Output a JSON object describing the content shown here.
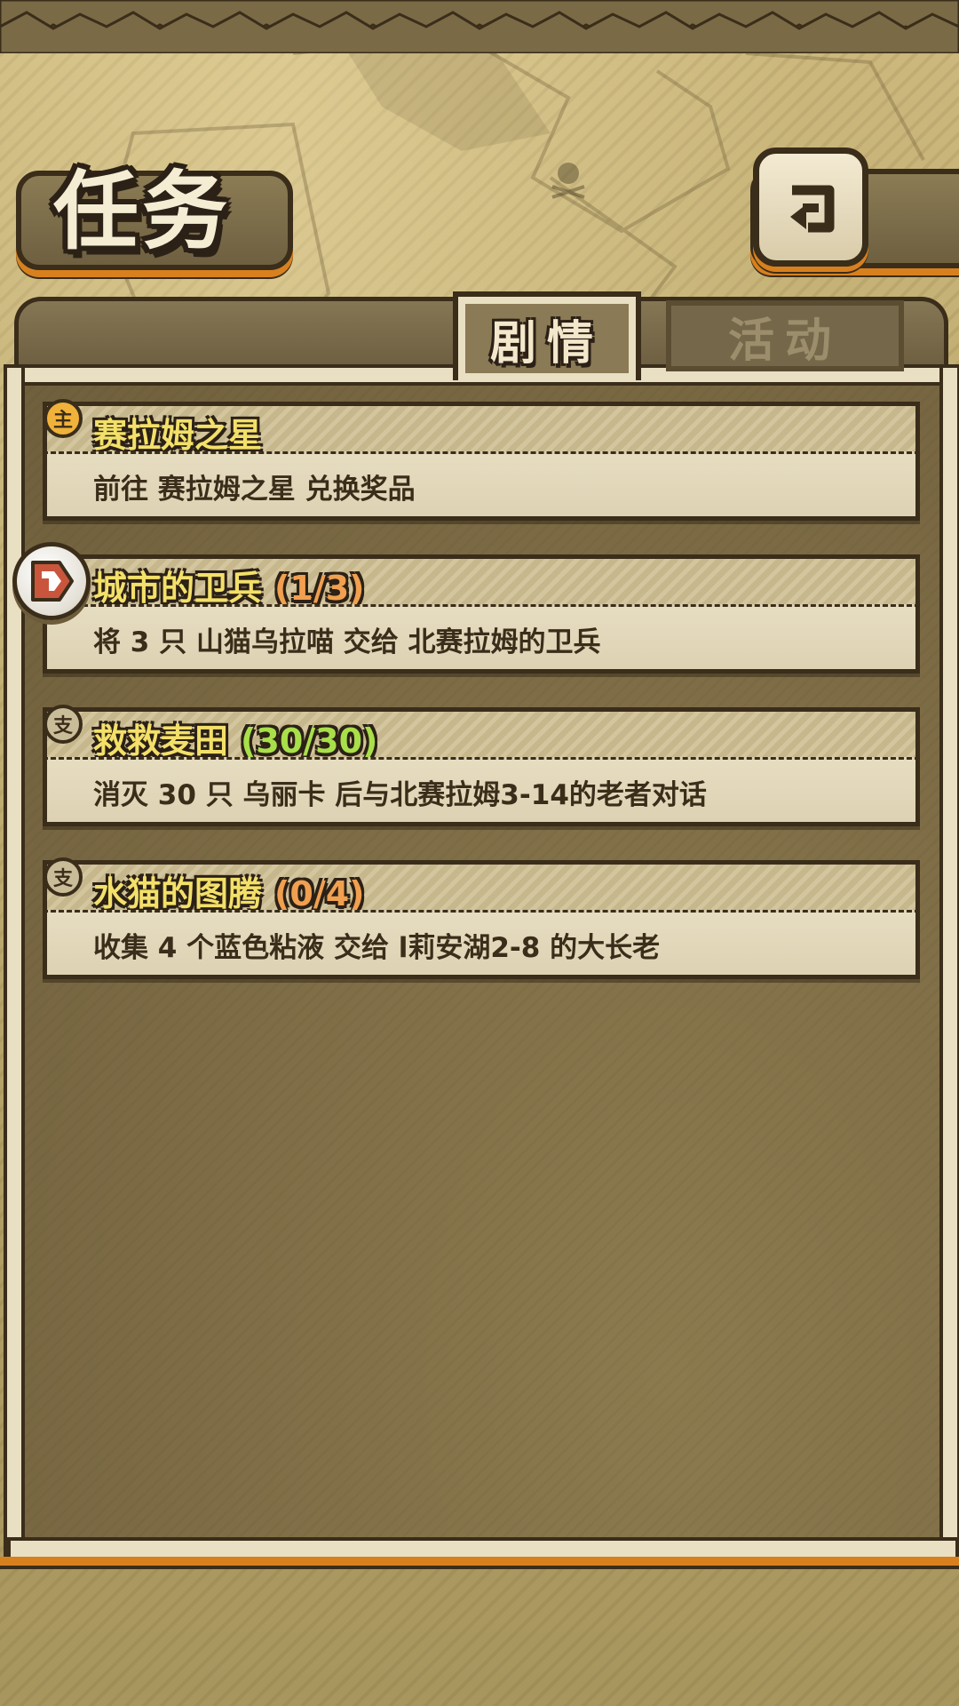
{
  "header": {
    "title": "任务",
    "back_icon": "return-arrow-icon"
  },
  "tabs": [
    {
      "label": "剧情",
      "active": true
    },
    {
      "label": "活动",
      "active": false
    }
  ],
  "quests": [
    {
      "icon": "main-quest-badge-icon",
      "icon_glyph": "主",
      "title": "赛拉姆之星",
      "progress": "",
      "progress_color": "",
      "description": "前往 赛拉姆之星 兑换奖品",
      "tracked": false
    },
    {
      "icon": "tracking-pin-icon",
      "icon_glyph": "",
      "title": "城市的卫兵",
      "progress": "(1/3)",
      "progress_color": "#f0a050",
      "description": "将 3 只 山猫乌拉喵 交给 北赛拉姆的卫兵",
      "tracked": true
    },
    {
      "icon": "side-quest-badge-icon",
      "icon_glyph": "支",
      "title": "救救麦田",
      "progress": "(30/30)",
      "progress_color": "#a8e04a",
      "description": "消灭 30 只 乌丽卡 后与北赛拉姆3-14的老者对话",
      "tracked": false
    },
    {
      "icon": "side-quest-badge-icon",
      "icon_glyph": "支",
      "title": "水猫的图腾",
      "progress": "(0/4)",
      "progress_color": "#f0a050",
      "description": "收集 4 个蓝色粘液 交给 l莉安湖2-8 的大长老",
      "tracked": false
    }
  ],
  "colors": {
    "quest_title": "#f3e06a",
    "accent_orange": "#d8801e",
    "outline": "#3a2d1a"
  }
}
